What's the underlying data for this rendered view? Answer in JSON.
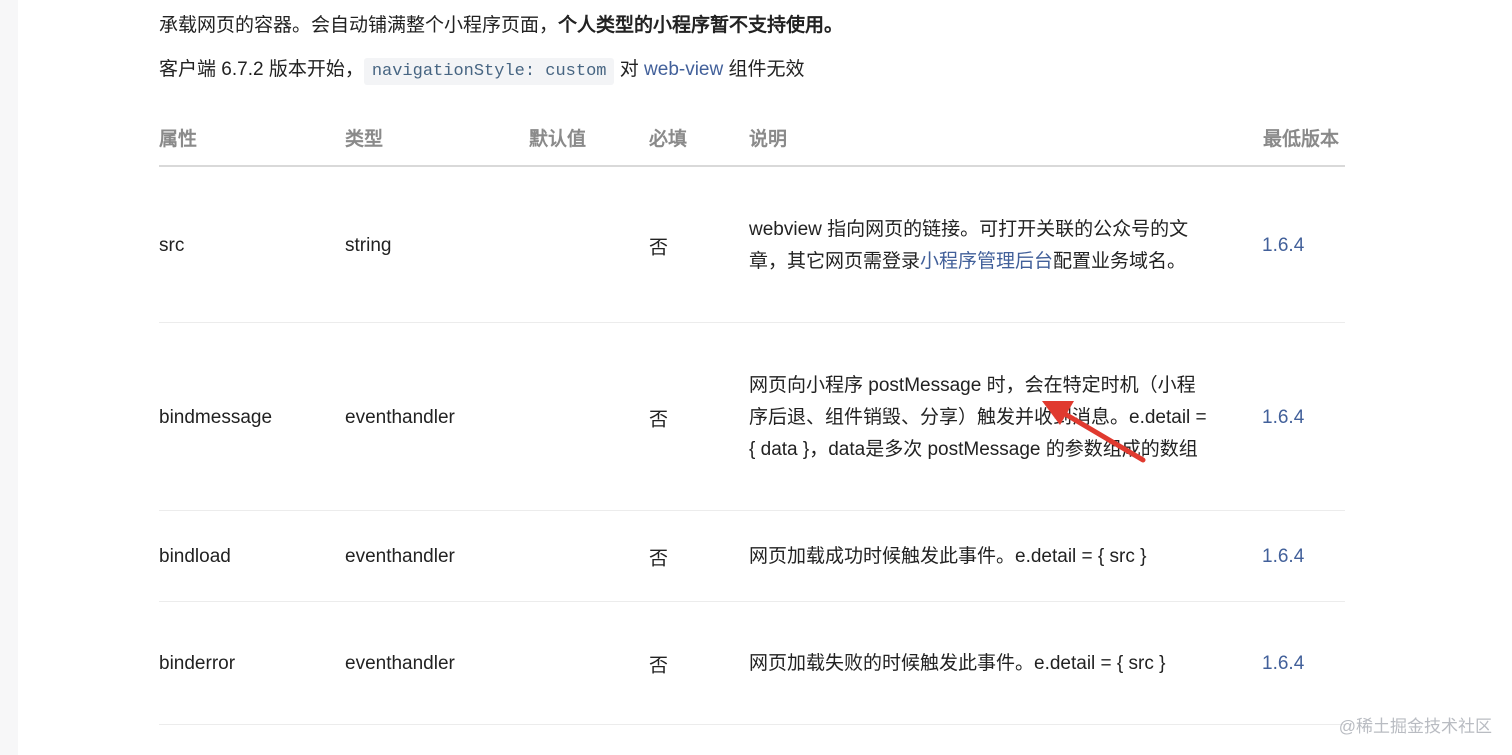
{
  "intro": {
    "line1_prefix": "承载网页的容器。会自动铺满整个小程序页面，",
    "line1_bold": "个人类型的小程序暂不支持使用。",
    "line2_prefix": "客户端 6.7.2 版本开始，",
    "line2_code": "navigationStyle: custom",
    "line2_mid": " 对 ",
    "line2_link": "web-view",
    "line2_suffix": " 组件无效"
  },
  "table": {
    "headers": {
      "attr": "属性",
      "type": "类型",
      "default": "默认值",
      "required": "必填",
      "desc": "说明",
      "version": "最低版本"
    },
    "rows": [
      {
        "attr": "src",
        "type": "string",
        "required": "否",
        "desc_before": "webview 指向网页的链接。可打开关联的公众号的文章，其它网页需登录",
        "desc_link": "小程序管理后台",
        "desc_after": "配置业务域名。",
        "version": "1.6.4"
      },
      {
        "attr": "bindmessage",
        "type": "eventhandler",
        "required": "否",
        "desc_before": "网页向小程序 postMessage 时，会在特定时机（小程序后退、组件销毁、分享）触发并收到消息。e.detail = { data }，data是多次 postMessage 的参数组成的数组",
        "desc_link": "",
        "desc_after": "",
        "version": "1.6.4"
      },
      {
        "attr": "bindload",
        "type": "eventhandler",
        "required": "否",
        "desc_before": "网页加载成功时候触发此事件。e.detail = { src }",
        "desc_link": "",
        "desc_after": "",
        "version": "1.6.4"
      },
      {
        "attr": "binderror",
        "type": "eventhandler",
        "required": "否",
        "desc_before": "网页加载失败的时候触发此事件。e.detail = { src }",
        "desc_link": "",
        "desc_after": "",
        "version": "1.6.4"
      }
    ]
  },
  "watermark": "@稀土掘金技术社区",
  "colors": {
    "link": "#42609a",
    "header_text": "#8a8a8a",
    "arrow": "#e03a2f"
  }
}
